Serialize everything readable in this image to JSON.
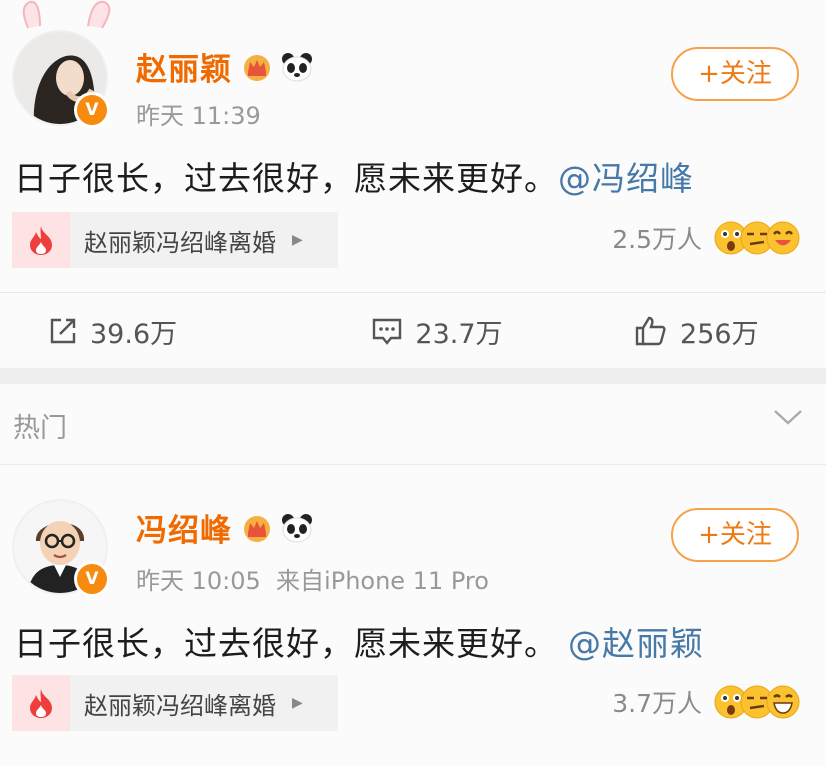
{
  "post1": {
    "username": "赵丽颖",
    "meta": "昨天 11:39",
    "follow_label": "+关注",
    "content_text": "日子很长，过去很好，愿未来更好。",
    "mention": "@冯绍峰",
    "topic": "赵丽颖冯绍峰离婚",
    "heat_count": "2.5万人",
    "actions": {
      "repost": "39.6万",
      "comment": "23.7万",
      "like": "256万"
    }
  },
  "hot_section": {
    "label": "热门"
  },
  "post2": {
    "username": "冯绍峰",
    "meta": "昨天 10:05  来自iPhone 11 Pro",
    "follow_label": "+关注",
    "content_text": "日子很长，过去很好，愿未来更好。",
    "mention": "@赵丽颖",
    "topic": "赵丽颖冯绍峰离婚",
    "heat_count": "3.7万人"
  },
  "colors": {
    "username": "#f06a00",
    "mention": "#4679a8",
    "follow_border": "#f5a24b",
    "verified": "#f78b10"
  },
  "icons": [
    "crown-icon",
    "panda-icon",
    "fire-icon",
    "repost-icon",
    "comment-icon",
    "like-icon",
    "chevron-down-icon",
    "verified-badge-icon"
  ]
}
